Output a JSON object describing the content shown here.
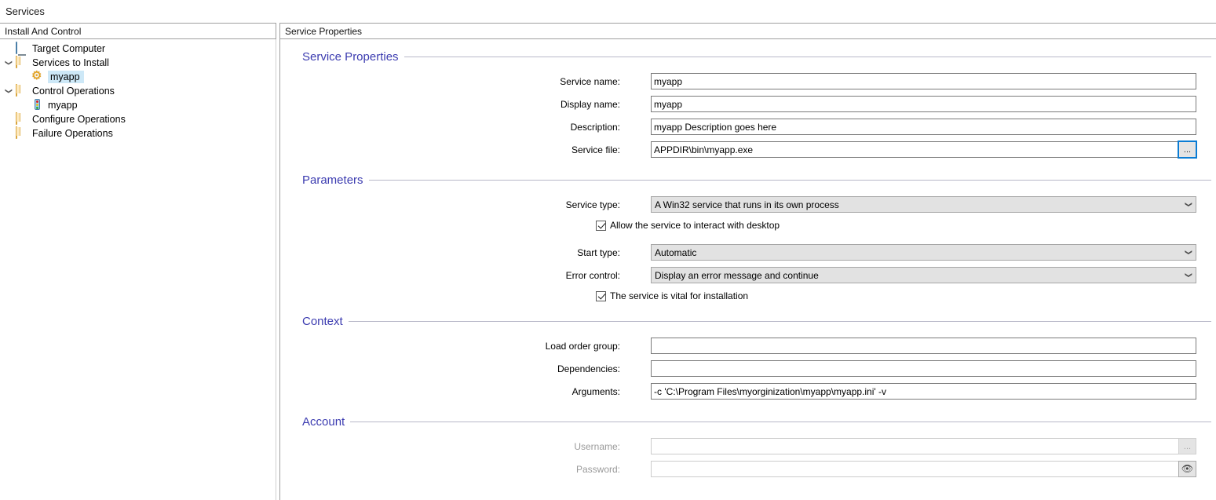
{
  "window": {
    "title": "Services"
  },
  "left_panel": {
    "header": "Install And Control",
    "tree": [
      {
        "label": "Target Computer",
        "icon": "monitor-icon",
        "depth": 0,
        "twisty": "",
        "selected": false
      },
      {
        "label": "Services to Install",
        "icon": "folder-icon",
        "depth": 1,
        "twisty": "v",
        "selected": false
      },
      {
        "label": "myapp",
        "icon": "gear-icon",
        "depth": 2,
        "twisty": "",
        "selected": true
      },
      {
        "label": "Control Operations",
        "icon": "folder-icon",
        "depth": 1,
        "twisty": "v",
        "selected": false
      },
      {
        "label": "myapp",
        "icon": "traffic-light-icon",
        "depth": 2,
        "twisty": "",
        "selected": false
      },
      {
        "label": "Configure Operations",
        "icon": "folder-icon",
        "depth": 1,
        "twisty": "",
        "selected": false
      },
      {
        "label": "Failure Operations",
        "icon": "folder-icon",
        "depth": 1,
        "twisty": "",
        "selected": false
      }
    ]
  },
  "right_panel": {
    "header": "Service Properties",
    "groups": {
      "service_properties": {
        "title": "Service Properties",
        "service_name": {
          "label": "Service name:",
          "value": "myapp"
        },
        "display_name": {
          "label": "Display name:",
          "value": "myapp"
        },
        "description": {
          "label": "Description:",
          "value": "myapp Description goes here"
        },
        "service_file": {
          "label": "Service file:",
          "value": "APPDIR\\bin\\myapp.exe",
          "browse_label": "..."
        }
      },
      "parameters": {
        "title": "Parameters",
        "service_type": {
          "label": "Service type:",
          "value": "A Win32 service that runs in its own process"
        },
        "interact": {
          "label": "Allow the service to interact with desktop",
          "checked": true
        },
        "start_type": {
          "label": "Start type:",
          "value": "Automatic"
        },
        "error_control": {
          "label": "Error control:",
          "value": "Display an error message and continue"
        },
        "vital": {
          "label": "The service is vital for installation",
          "checked": true
        }
      },
      "context": {
        "title": "Context",
        "load_order": {
          "label": "Load order group:",
          "value": ""
        },
        "dependencies": {
          "label": "Dependencies:",
          "value": ""
        },
        "arguments": {
          "label": "Arguments:",
          "value": "-c 'C:\\Program Files\\myorginization\\myapp\\myapp.ini' -v"
        }
      },
      "account": {
        "title": "Account",
        "username": {
          "label": "Username:",
          "value": "",
          "browse_label": "..."
        },
        "password": {
          "label": "Password:",
          "value": "",
          "reveal_icon": "eye-icon"
        }
      }
    }
  },
  "colors": {
    "group_title": "#3b3bb0",
    "selection": "#cde8f7",
    "focus_ring": "#0a7cd4"
  }
}
